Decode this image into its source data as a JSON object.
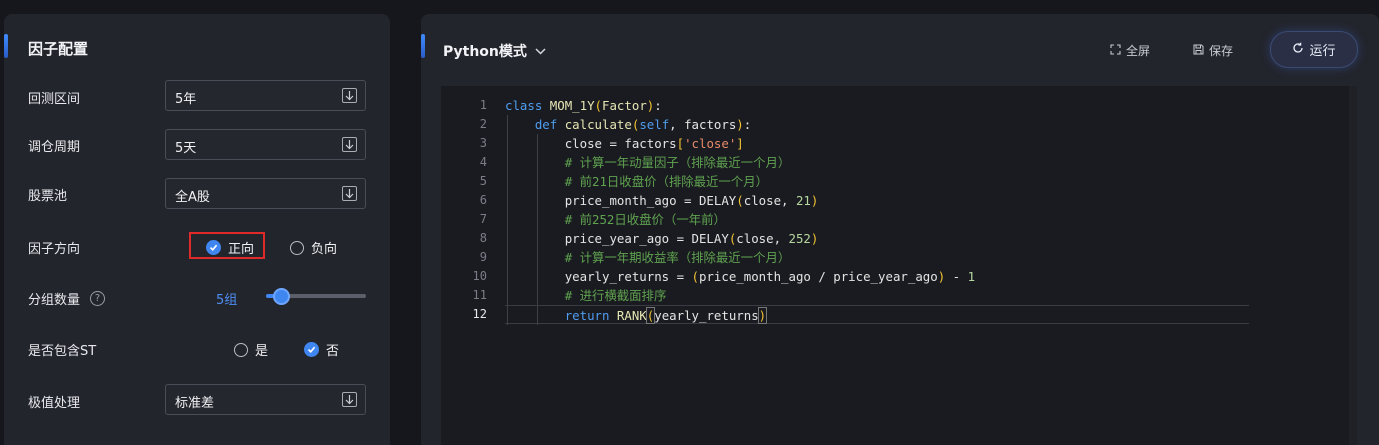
{
  "left_panel": {
    "title": "因子配置",
    "backtest_period": {
      "label": "回测区间",
      "value": "5年"
    },
    "rebalance_period": {
      "label": "调仓周期",
      "value": "5天"
    },
    "stock_pool": {
      "label": "股票池",
      "value": "全A股"
    },
    "factor_direction": {
      "label": "因子方向",
      "positive": "正向",
      "negative": "负向",
      "selected": "正向"
    },
    "group_count": {
      "label": "分组数量",
      "help": "?",
      "value_text": "5组",
      "value": 5,
      "fill_fraction": 0.2
    },
    "include_st": {
      "label": "是否包含ST",
      "yes": "是",
      "no": "否",
      "selected": "否"
    },
    "outlier_handling": {
      "label": "极值处理",
      "value": "标准差"
    }
  },
  "editor_panel": {
    "mode_title": "Python模式",
    "fullscreen_label": "全屏",
    "save_label": "保存",
    "run_label": "运行",
    "active_line": 12,
    "line_numbers": [
      "1",
      "2",
      "3",
      "4",
      "5",
      "6",
      "7",
      "8",
      "9",
      "10",
      "11",
      "12"
    ]
  },
  "code": {
    "l1": {
      "kw": "class",
      "name": "MOM_1Y",
      "open": "(",
      "base": "Factor",
      "close": ")",
      "colon": ":"
    },
    "l2": {
      "kw": "def",
      "name": "calculate",
      "open": "(",
      "self": "self",
      "rest": ", factors",
      "close": ")",
      "colon": ":"
    },
    "l3": {
      "pre": "close = factors",
      "open": "[",
      "str": "'close'",
      "close": "]"
    },
    "l4": "# 计算一年动量因子（排除最近一个月）",
    "l5": "# 前21日收盘价（排除最近一个月）",
    "l6": {
      "pre": "price_month_ago = DELAY",
      "open": "(",
      "mid": "close, ",
      "num": "21",
      "close": ")"
    },
    "l7": "# 前252日收盘价（一年前）",
    "l8": {
      "pre": "price_year_ago = DELAY",
      "open": "(",
      "mid": "close, ",
      "num": "252",
      "close": ")"
    },
    "l9": "# 计算一年期收益率（排除最近一个月）",
    "l10": {
      "pre": "yearly_returns = ",
      "open": "(",
      "mid": "price_month_ago / price_year_ago",
      "close": ")",
      "post": " - ",
      "num": "1"
    },
    "l11": "# 进行横截面排序",
    "l12": {
      "kw": "return",
      "name": " RANK",
      "open": "(",
      "mid": "yearly_returns",
      "close": ")"
    }
  },
  "colors": {
    "accent": "#3f86f0",
    "highlight_border": "#e02a2a",
    "keyword": "#4f9cf0",
    "comment": "#5fa24f",
    "string": "#e68a6a"
  },
  "icons": {
    "dropdown": "arrow-down-box-icon",
    "fullscreen": "fullscreen-icon",
    "save": "floppy-icon",
    "run": "refresh-icon",
    "mode_menu": "chevron-down-icon"
  }
}
